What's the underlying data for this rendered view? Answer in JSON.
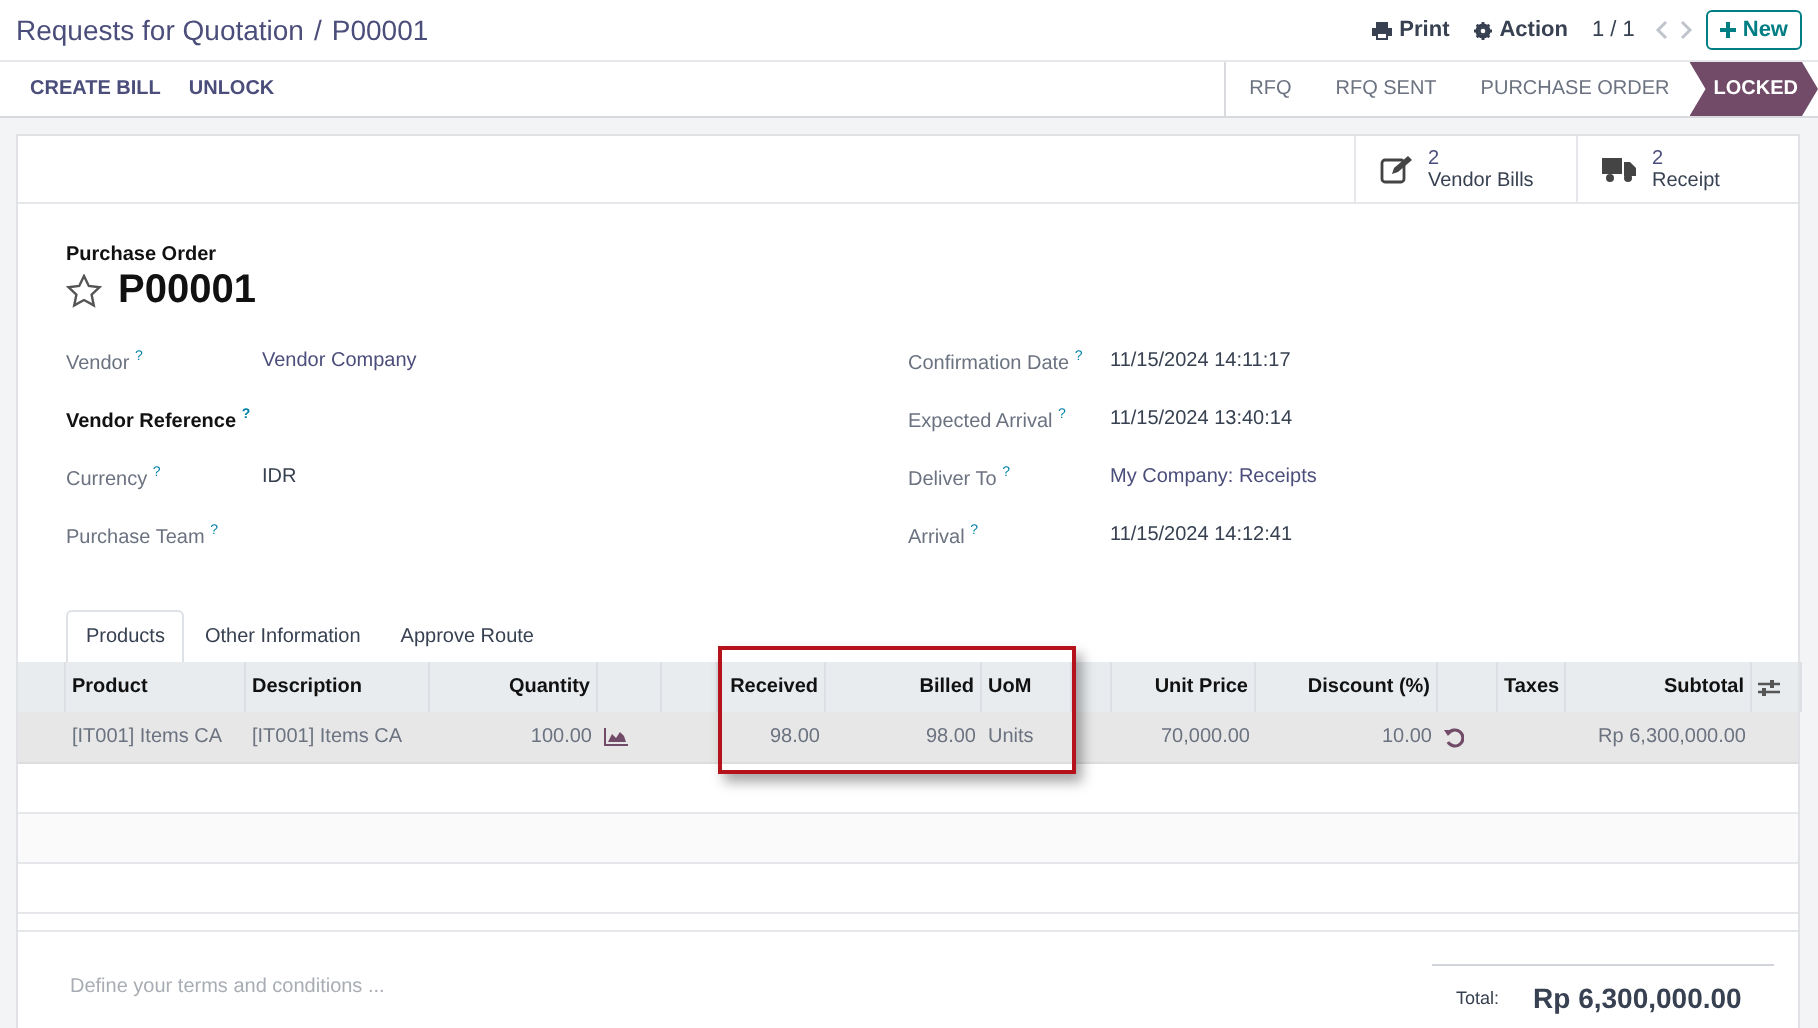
{
  "breadcrumb": {
    "parent": "Requests for Quotation",
    "separator": "/",
    "current": "P00001"
  },
  "top_actions": {
    "print": "Print",
    "action": "Action",
    "pager": "1 / 1",
    "new_button": "New"
  },
  "action_buttons": [
    "CREATE BILL",
    "UNLOCK"
  ],
  "stages": [
    {
      "label": "RFQ",
      "selected": false
    },
    {
      "label": "RFQ SENT",
      "selected": false
    },
    {
      "label": "PURCHASE ORDER",
      "selected": false
    },
    {
      "label": "LOCKED",
      "selected": true
    }
  ],
  "smart_buttons": [
    {
      "kind": "bills",
      "count": "2",
      "label": "Vendor Bills"
    },
    {
      "kind": "receipt",
      "count": "2",
      "label": "Receipt"
    }
  ],
  "form": {
    "subtitle": "Purchase Order",
    "title": "P00001",
    "starred": false,
    "left_fields": [
      {
        "label": "Vendor $^{?}$",
        "value": "Vendor Company",
        "link": true,
        "bold": false
      },
      {
        "label": "Vendor Reference $^{?}$",
        "bold": true
      },
      {
        "label": "Currency $^{?}$",
        "value": "IDR",
        "link": false,
        "bold": false
      },
      {
        "label": "Purchase Team $^{?}$",
        "bold": false
      }
    ],
    "right_fields": [
      {
        "label": "Confirmation Date $^{?}$",
        "value": "11/15/2024 14:11:17",
        "link": false
      },
      {
        "label": "Expected Arrival $^{?}$",
        "value": "11/15/2024 13:40:14",
        "link": false
      },
      {
        "label": "Deliver To $^{?}$",
        "value": "My Company: Receipts",
        "link": true
      },
      {
        "label": "Arrival $^{?}$",
        "value": "11/15/2024 14:12:41",
        "link": false
      }
    ]
  },
  "tabs": [
    {
      "label": "Products",
      "selected": true
    },
    {
      "label": "Other Information",
      "selected": false
    },
    {
      "label": "Approve Route",
      "selected": false
    }
  ],
  "table": {
    "columns": [
      {
        "kind": "text",
        "label": "Product"
      },
      {
        "kind": "text",
        "label": "Description"
      },
      {
        "kind": "number",
        "label": "Quantity"
      },
      {
        "kind": "number",
        "label": "Received"
      },
      {
        "kind": "number",
        "label": "Billed"
      },
      {
        "kind": "text",
        "label": "UoM"
      },
      {
        "kind": "number",
        "label": "Unit Price"
      },
      {
        "kind": "number",
        "label": "Discount (%)"
      },
      {
        "kind": "text",
        "label": "Taxes"
      },
      {
        "kind": "number",
        "label": "Subtotal"
      }
    ],
    "rows": [
      {
        "cells": [
          "[IT001] Items CA",
          "[IT001] Items CA",
          "100.00",
          "98.00",
          "98.00",
          "Units",
          "70,000.00",
          "10.00",
          "",
          "Rp 6,300,000.00"
        ]
      }
    ]
  },
  "footer": {
    "terms_placeholder": "Define your terms and conditions ...",
    "total_label": "Total:",
    "total_value": "Rp 6,300,000.00"
  }
}
